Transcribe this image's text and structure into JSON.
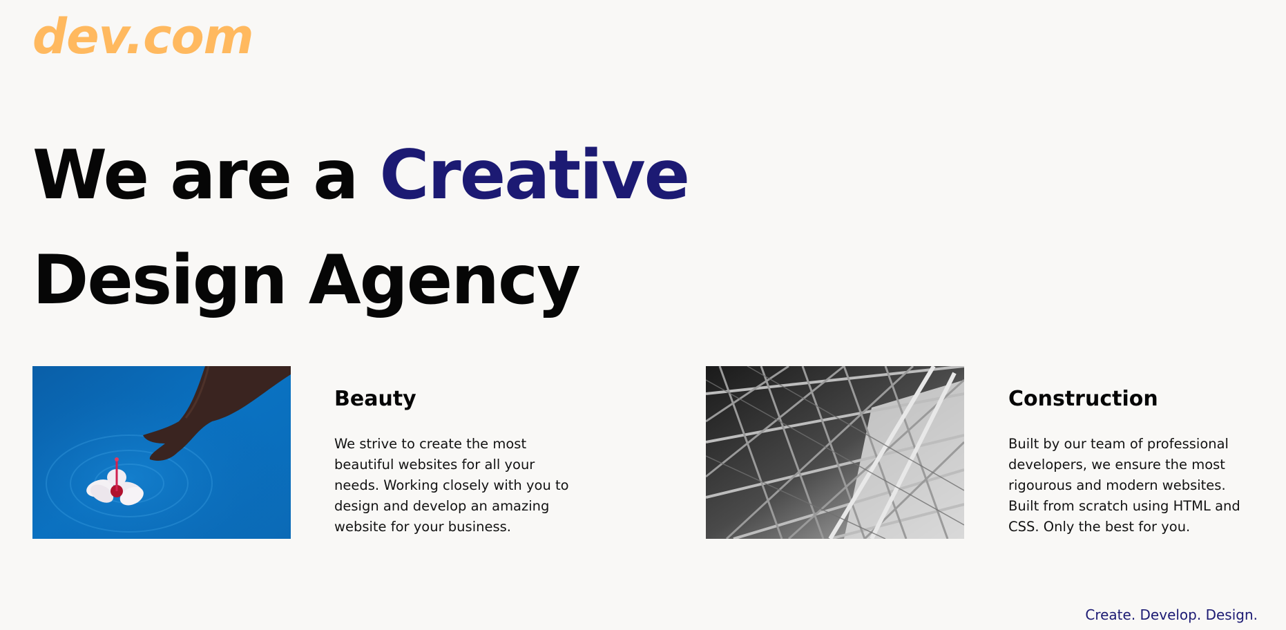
{
  "brand": {
    "logo_text": "dev.com",
    "logo_color": "#ffb95f"
  },
  "hero": {
    "line1_prefix": "We are a ",
    "line1_accent": "Creative",
    "line2": "Design Agency",
    "accent_color": "#1c1a73"
  },
  "services": [
    {
      "title": "Beauty",
      "body": "We strive to create the most beautiful websites for all your needs. Working closely with you to design and develop an amazing website for your business.",
      "image_description": "hand-touching-flower-in-water-photo"
    },
    {
      "title": "Construction",
      "body": "Built by our team of professional developers, we ensure the most rigourous and modern websites. Built from scratch using HTML and CSS. Only the best for you.",
      "image_description": "steel-structure-photo"
    }
  ],
  "footer": {
    "tagline": "Create. Develop. Design."
  },
  "colors": {
    "background": "#f9f8f6",
    "text": "#060606"
  }
}
